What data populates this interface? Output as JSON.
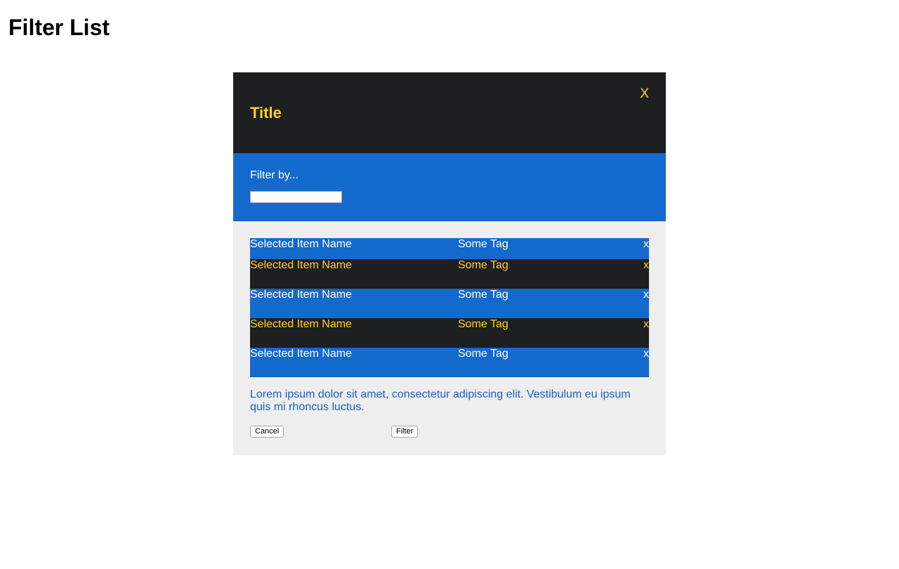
{
  "page": {
    "title": "Filter List"
  },
  "modal": {
    "title": "Title",
    "close_label": "X",
    "filter_label": "Filter by...",
    "filter_value": "",
    "items": [
      {
        "name": "Selected Item Name",
        "tag": "Some Tag",
        "remove_label": "x"
      },
      {
        "name": "Selected Item Name",
        "tag": "Some Tag",
        "remove_label": "x"
      },
      {
        "name": "Selected Item Name",
        "tag": "Some Tag",
        "remove_label": "x"
      },
      {
        "name": "Selected Item Name",
        "tag": "Some Tag",
        "remove_label": "x"
      },
      {
        "name": "Selected Item Name",
        "tag": "Some Tag",
        "remove_label": "x"
      }
    ],
    "description": "Lorem ipsum dolor sit amet, consectetur adipiscing elit. Vestibulum eu ipsum quis mi rhoncus luctus.",
    "cancel_label": "Cancel",
    "filter_button_label": "Filter"
  },
  "colors": {
    "dark": "#1e1f21",
    "blue": "#1469cc",
    "accent_yellow": "#ffd21f",
    "panel_gray": "#eeeeee",
    "description_blue": "#1a5fc4"
  }
}
